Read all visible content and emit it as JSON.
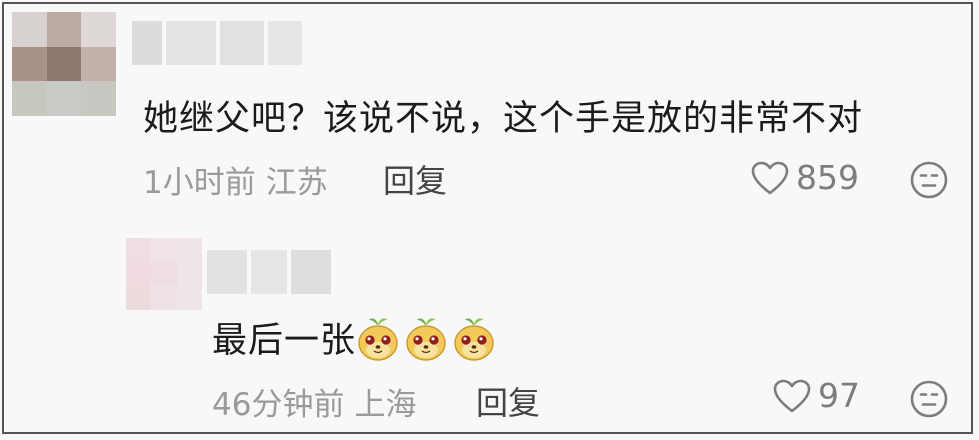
{
  "comments": [
    {
      "text": "她继父吧？该说不说，这个手是放的非常不对",
      "time": "1小时前",
      "location": "江苏",
      "reply_label": "回复",
      "likes": "859"
    },
    {
      "text": "最后一张",
      "emoji_count": 3,
      "emoji_icon": "cute-mascot-emoji-icon",
      "time": "46分钟前",
      "location": "上海",
      "reply_label": "回复",
      "likes": "97"
    }
  ],
  "icons": {
    "like": "heart-outline-icon",
    "reaction": "neutral-face-icon"
  },
  "colors": {
    "background": "#f8f8f8",
    "text": "#1b1b1b",
    "meta": "#9a9a9a",
    "reply": "#444444",
    "icon": "#7d7d7d",
    "border": "#555555"
  }
}
